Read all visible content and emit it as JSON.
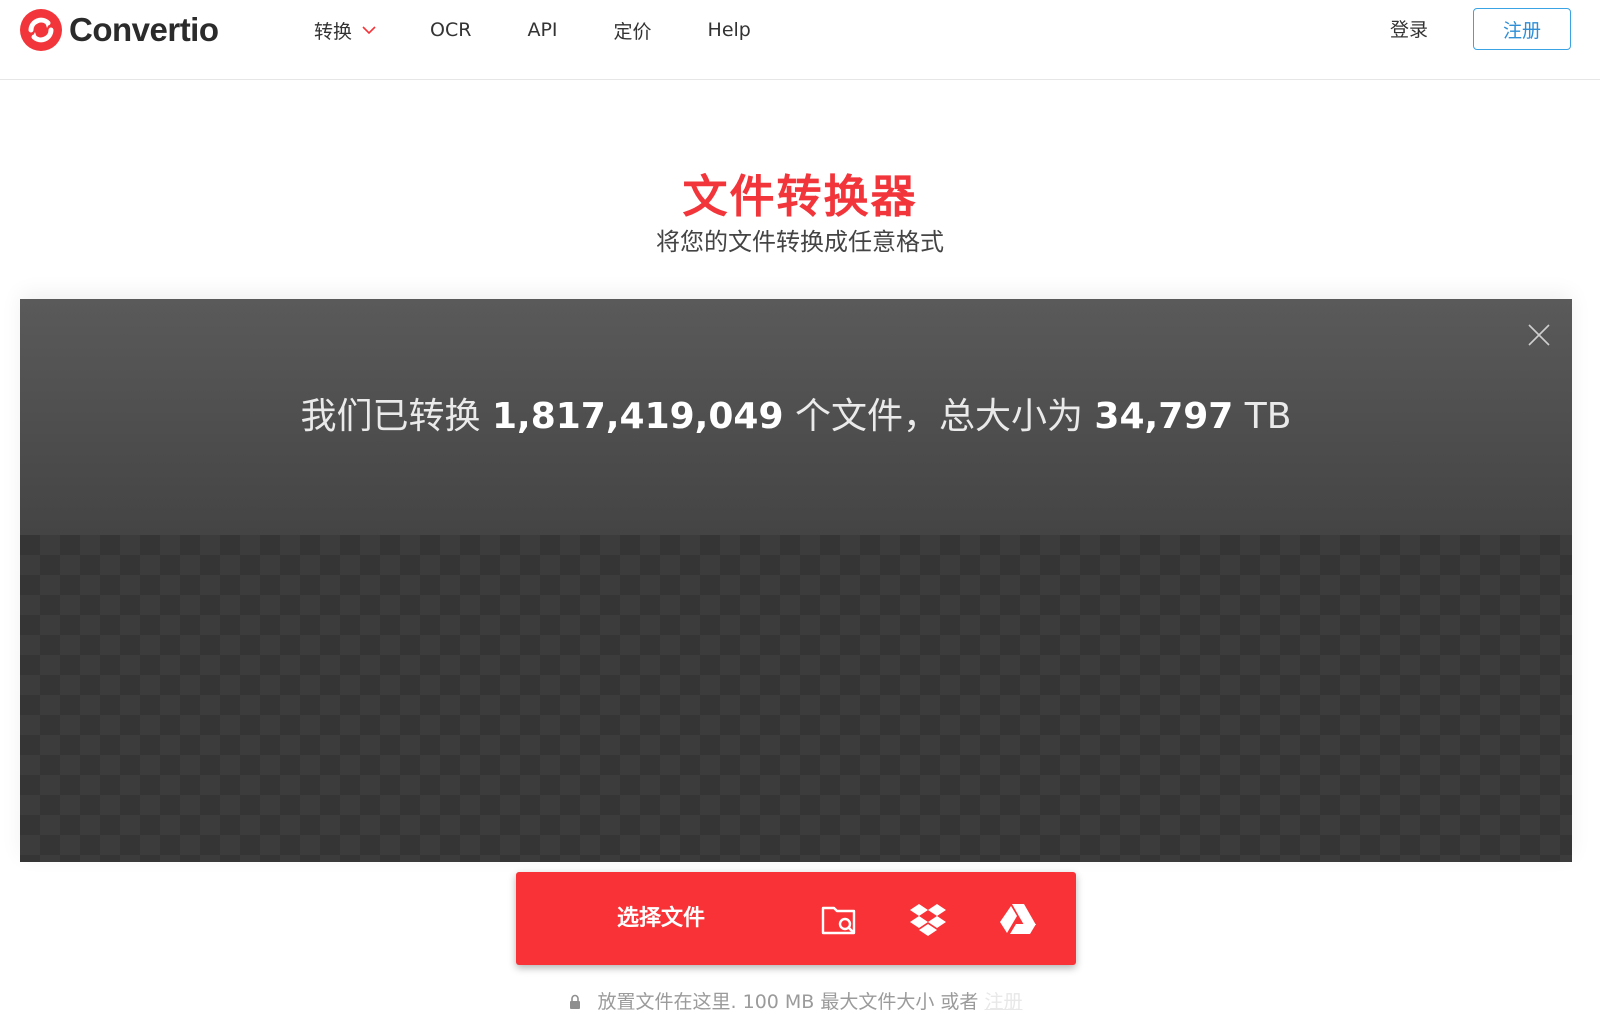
{
  "brand": {
    "name": "Convertio",
    "color": "#f2353a"
  },
  "nav": {
    "items": [
      {
        "label": "转换",
        "has_dropdown": true
      },
      {
        "label": "OCR"
      },
      {
        "label": "API"
      },
      {
        "label": "定价"
      },
      {
        "label": "Help"
      }
    ],
    "login_label": "登录",
    "signup_label": "注册"
  },
  "hero": {
    "title": "文件转换器",
    "subtitle": "将您的文件转换成任意格式"
  },
  "converter": {
    "stats": {
      "prefix": "我们已转换",
      "file_count": "1,817,419,049",
      "middle": "个文件，总大小为",
      "total_size": "34,797",
      "unit": "TB"
    },
    "choose_label": "选择文件",
    "sources": [
      "folder-search-icon",
      "dropbox-icon",
      "google-drive-icon"
    ],
    "drop_hint": "放置文件在这里. 100 MB 最大文件大小 或者",
    "drop_hint_link": "注册",
    "accent": "#f83236"
  }
}
